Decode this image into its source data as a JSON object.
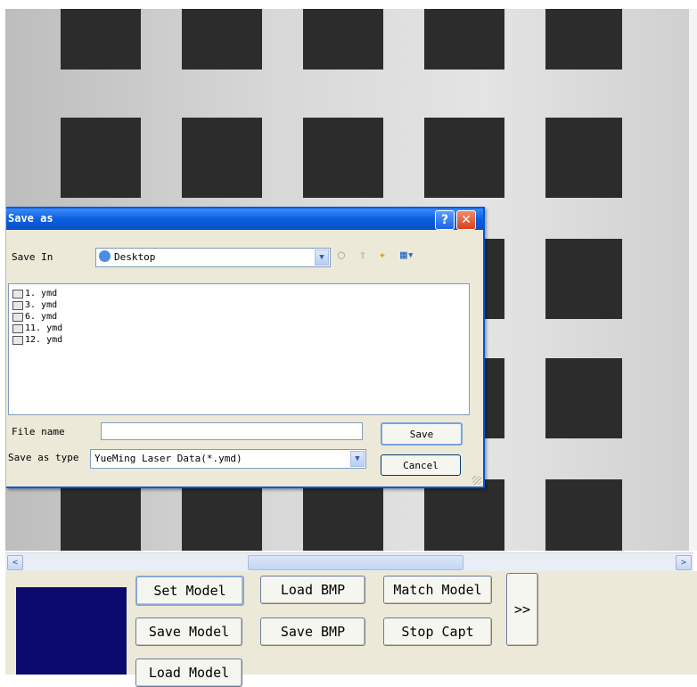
{
  "dialog": {
    "title": "Save as",
    "help_icon": "help-icon",
    "close_icon": "close-icon",
    "save_in_label": "Save In",
    "save_in_value": "Desktop",
    "files": [
      "1. ymd",
      "3. ymd",
      "6. ymd",
      "11. ymd",
      "12. ymd"
    ],
    "file_name_label": "File name",
    "file_name_value": "",
    "save_as_type_label": "Save as type",
    "save_as_type_value": "YueMing Laser Data(*.ymd)",
    "save_button": "Save",
    "cancel_button": "Cancel",
    "help_glyph": "?",
    "close_glyph": "✕"
  },
  "scrollbar": {
    "left_arrow": "<",
    "right_arrow": ">"
  },
  "panel": {
    "color_swatch": "#0b0b6d",
    "buttons": {
      "set_model": "Set Model",
      "load_bmp": "Load BMP",
      "match_model": "Match Model",
      "more": ">>",
      "save_model": "Save Model",
      "save_bmp": "Save BMP",
      "stop_capt": "Stop Capt",
      "load_model": "Load Model"
    }
  },
  "colors": {
    "title_bar": "#0a5fe0",
    "panel_bg": "#ece9d8",
    "swatch": "#0b0b6d"
  }
}
